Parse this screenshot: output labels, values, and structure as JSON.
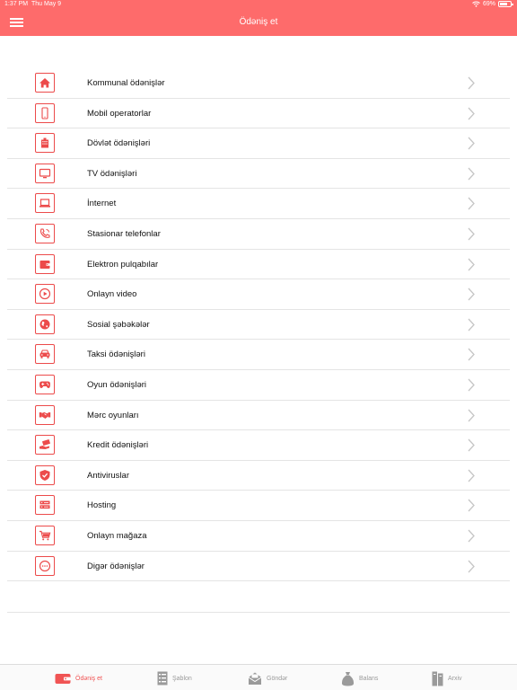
{
  "status": {
    "time": "1:37 PM",
    "date": "Thu May 9",
    "battery": "69%",
    "battery_level": 0.69
  },
  "header": {
    "title": "Ödəniş et"
  },
  "accent": "#fe6b6b",
  "icon_color": "#ec4b4b",
  "categories": [
    {
      "label": "Kommunal ödənişlər",
      "icon": "home-icon"
    },
    {
      "label": "Mobil operatorlar",
      "icon": "mobile-phone-icon"
    },
    {
      "label": "Dövlət ödənişləri",
      "icon": "government-building-icon"
    },
    {
      "label": "TV ödənişləri",
      "icon": "tv-icon"
    },
    {
      "label": "İnternet",
      "icon": "laptop-icon"
    },
    {
      "label": "Stasionar telefonlar",
      "icon": "landline-phone-icon"
    },
    {
      "label": "Elektron pulqabılar",
      "icon": "wallet-icon"
    },
    {
      "label": "Onlayn video",
      "icon": "play-icon"
    },
    {
      "label": "Sosial şəbəkələr",
      "icon": "globe-icon"
    },
    {
      "label": "Taksi ödənişləri",
      "icon": "taxi-icon"
    },
    {
      "label": "Oyun ödənişləri",
      "icon": "gamepad-icon"
    },
    {
      "label": "Mərc oyunları",
      "icon": "handshake-icon"
    },
    {
      "label": "Kredit ödənişləri",
      "icon": "credit-hand-icon"
    },
    {
      "label": "Antiviruslar",
      "icon": "shield-icon"
    },
    {
      "label": "Hosting",
      "icon": "server-icon"
    },
    {
      "label": "Onlayn mağaza",
      "icon": "shopping-cart-icon"
    },
    {
      "label": "Digər ödənişlər",
      "icon": "more-dots-icon"
    }
  ],
  "tabs": [
    {
      "label": "Ödəniş et",
      "icon": "wallet-tab-icon",
      "active": true
    },
    {
      "label": "Şablon",
      "icon": "template-tab-icon",
      "active": false
    },
    {
      "label": "Göndər",
      "icon": "send-envelope-icon",
      "active": false
    },
    {
      "label": "Balans",
      "icon": "money-bag-icon",
      "active": false
    },
    {
      "label": "Arxiv",
      "icon": "archive-icon",
      "active": false
    }
  ]
}
